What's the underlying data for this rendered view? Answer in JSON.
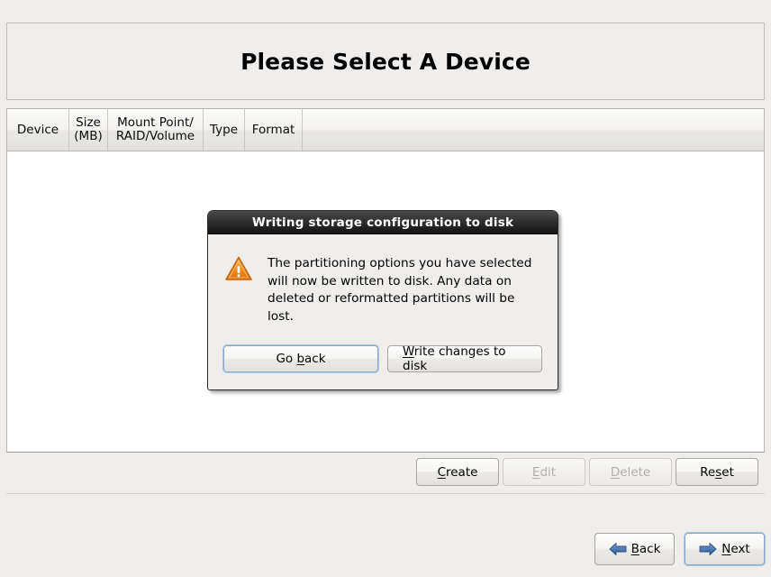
{
  "page": {
    "title": "Please Select A Device"
  },
  "device_table": {
    "columns": [
      {
        "label": "Device",
        "key": "device"
      },
      {
        "label": "Size\n(MB)",
        "key": "size"
      },
      {
        "label": "Mount Point/\nRAID/Volume",
        "key": "mount"
      },
      {
        "label": "Type",
        "key": "type"
      },
      {
        "label": "Format",
        "key": "format"
      }
    ],
    "rows": []
  },
  "actions": {
    "create": {
      "label": "Create",
      "enabled": true
    },
    "edit": {
      "label": "Edit",
      "enabled": false
    },
    "delete": {
      "label": "Delete",
      "enabled": false
    },
    "reset": {
      "label": "Reset",
      "enabled": true
    }
  },
  "navigation": {
    "back": {
      "label": "Back",
      "icon": "arrow-left-icon",
      "focused": false
    },
    "next": {
      "label": "Next",
      "icon": "arrow-right-icon",
      "focused": true
    }
  },
  "dialog": {
    "title": "Writing storage configuration to disk",
    "icon": "warning-triangle-icon",
    "message": "The partitioning options you have selected\nwill now be written to disk.  Any data on\ndeleted or reformatted partitions will be lost.",
    "buttons": {
      "go_back": {
        "label": "Go back",
        "focused": true
      },
      "write": {
        "label": "Write changes to disk",
        "focused": false
      }
    }
  },
  "colors": {
    "window_bg": "#efeeec",
    "list_bg": "#ffffff",
    "titlebar_dark": "#1a1a1a",
    "warning_orange": "#f0861e",
    "focus_blue": "#8aa8cc",
    "arrow_blue": "#3b6ba8",
    "disabled_text": "#b0aeaa"
  }
}
